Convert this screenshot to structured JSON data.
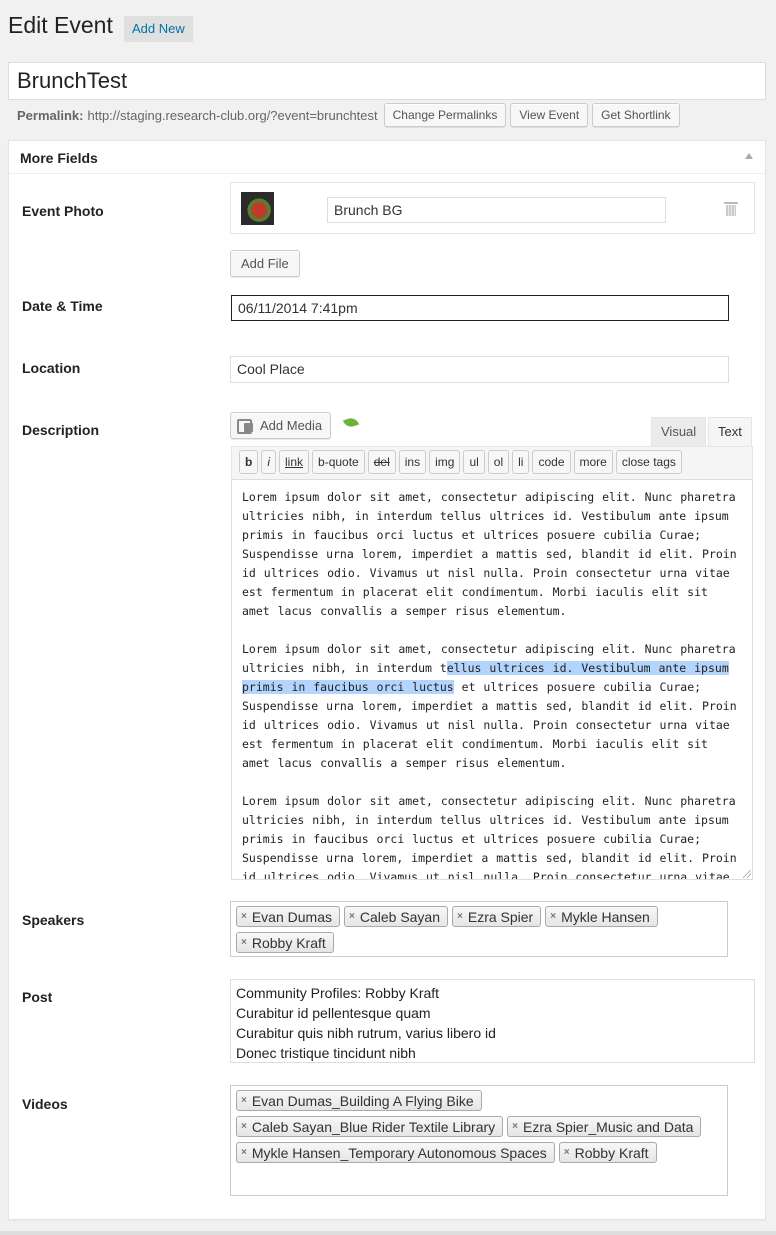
{
  "header": {
    "title": "Edit Event",
    "add_new": "Add New"
  },
  "post_title": "BrunchTest",
  "permalink": {
    "label": "Permalink:",
    "url": "http://staging.research-club.org/?event=brunchtest",
    "buttons": [
      "Change Permalinks",
      "View Event",
      "Get Shortlink"
    ]
  },
  "metabox": {
    "title": "More Fields"
  },
  "fields": {
    "event_photo": {
      "label": "Event Photo",
      "file_name": "Brunch BG",
      "add_file": "Add File"
    },
    "date_time": {
      "label": "Date & Time",
      "value": "06/11/2014 7:41pm"
    },
    "location": {
      "label": "Location",
      "value": "Cool Place"
    },
    "description": {
      "label": "Description",
      "add_media": "Add Media",
      "tabs": [
        "Visual",
        "Text"
      ],
      "active_tab": "Text",
      "quicktags": [
        "b",
        "i",
        "link",
        "b-quote",
        "del",
        "ins",
        "img",
        "ul",
        "ol",
        "li",
        "code",
        "more",
        "close tags"
      ],
      "paragraph_1": "Lorem ipsum dolor sit amet, consectetur adipiscing elit. Nunc pharetra ultricies nibh, in interdum tellus ultrices id. Vestibulum ante ipsum primis in faucibus orci luctus et ultrices posuere cubilia Curae; Suspendisse urna lorem, imperdiet a mattis sed, blandit id elit. Proin id ultrices odio. Vivamus ut nisl nulla. Proin consectetur urna vitae est fermentum in placerat elit condimentum. Morbi iaculis elit sit amet lacus convallis a semper risus elementum.",
      "paragraph_2_before": "Lorem ipsum dolor sit amet, consectetur adipiscing elit. Nunc pharetra ultricies nibh, in interdum t",
      "paragraph_2_selected": "ellus ultrices id. Vestibulum ante ipsum primis in faucibus orci luctus",
      "paragraph_2_after": " et ultrices posuere cubilia Curae; Suspendisse urna lorem, imperdiet a mattis sed, blandit id elit. Proin id ultrices odio. Vivamus ut nisl nulla. Proin consectetur urna vitae est fermentum in placerat elit condimentum. Morbi iaculis elit sit amet lacus convallis a semper risus elementum.",
      "paragraph_3": "Lorem ipsum dolor sit amet, consectetur adipiscing elit. Nunc pharetra ultricies nibh, in interdum tellus ultrices id. Vestibulum ante ipsum primis in faucibus orci luctus et ultrices posuere cubilia Curae; Suspendisse urna lorem, imperdiet a mattis sed, blandit id elit. Proin id ultrices odio. Vivamus ut nisl nulla. Proin consectetur urna vitae"
    },
    "speakers": {
      "label": "Speakers",
      "tokens": [
        "Evan Dumas",
        "Caleb Sayan",
        "Ezra Spier",
        "Mykle Hansen",
        "Robby Kraft"
      ]
    },
    "post": {
      "label": "Post",
      "items": [
        "Community Profiles: Robby Kraft",
        "Curabitur id pellentesque quam",
        "Curabitur quis nibh rutrum, varius libero id",
        "Donec tristique tincidunt nibh"
      ]
    },
    "videos": {
      "label": "Videos",
      "tokens": [
        "Evan Dumas_Building A Flying Bike",
        "Caleb Sayan_Blue Rider Textile Library",
        "Ezra Spier_Music and Data",
        "Mykle Hansen_Temporary Autonomous Spaces",
        "Robby Kraft"
      ]
    }
  },
  "icons": {
    "remove_token": "×",
    "trash": "trash-icon",
    "collapse": "triangle-up-icon"
  }
}
